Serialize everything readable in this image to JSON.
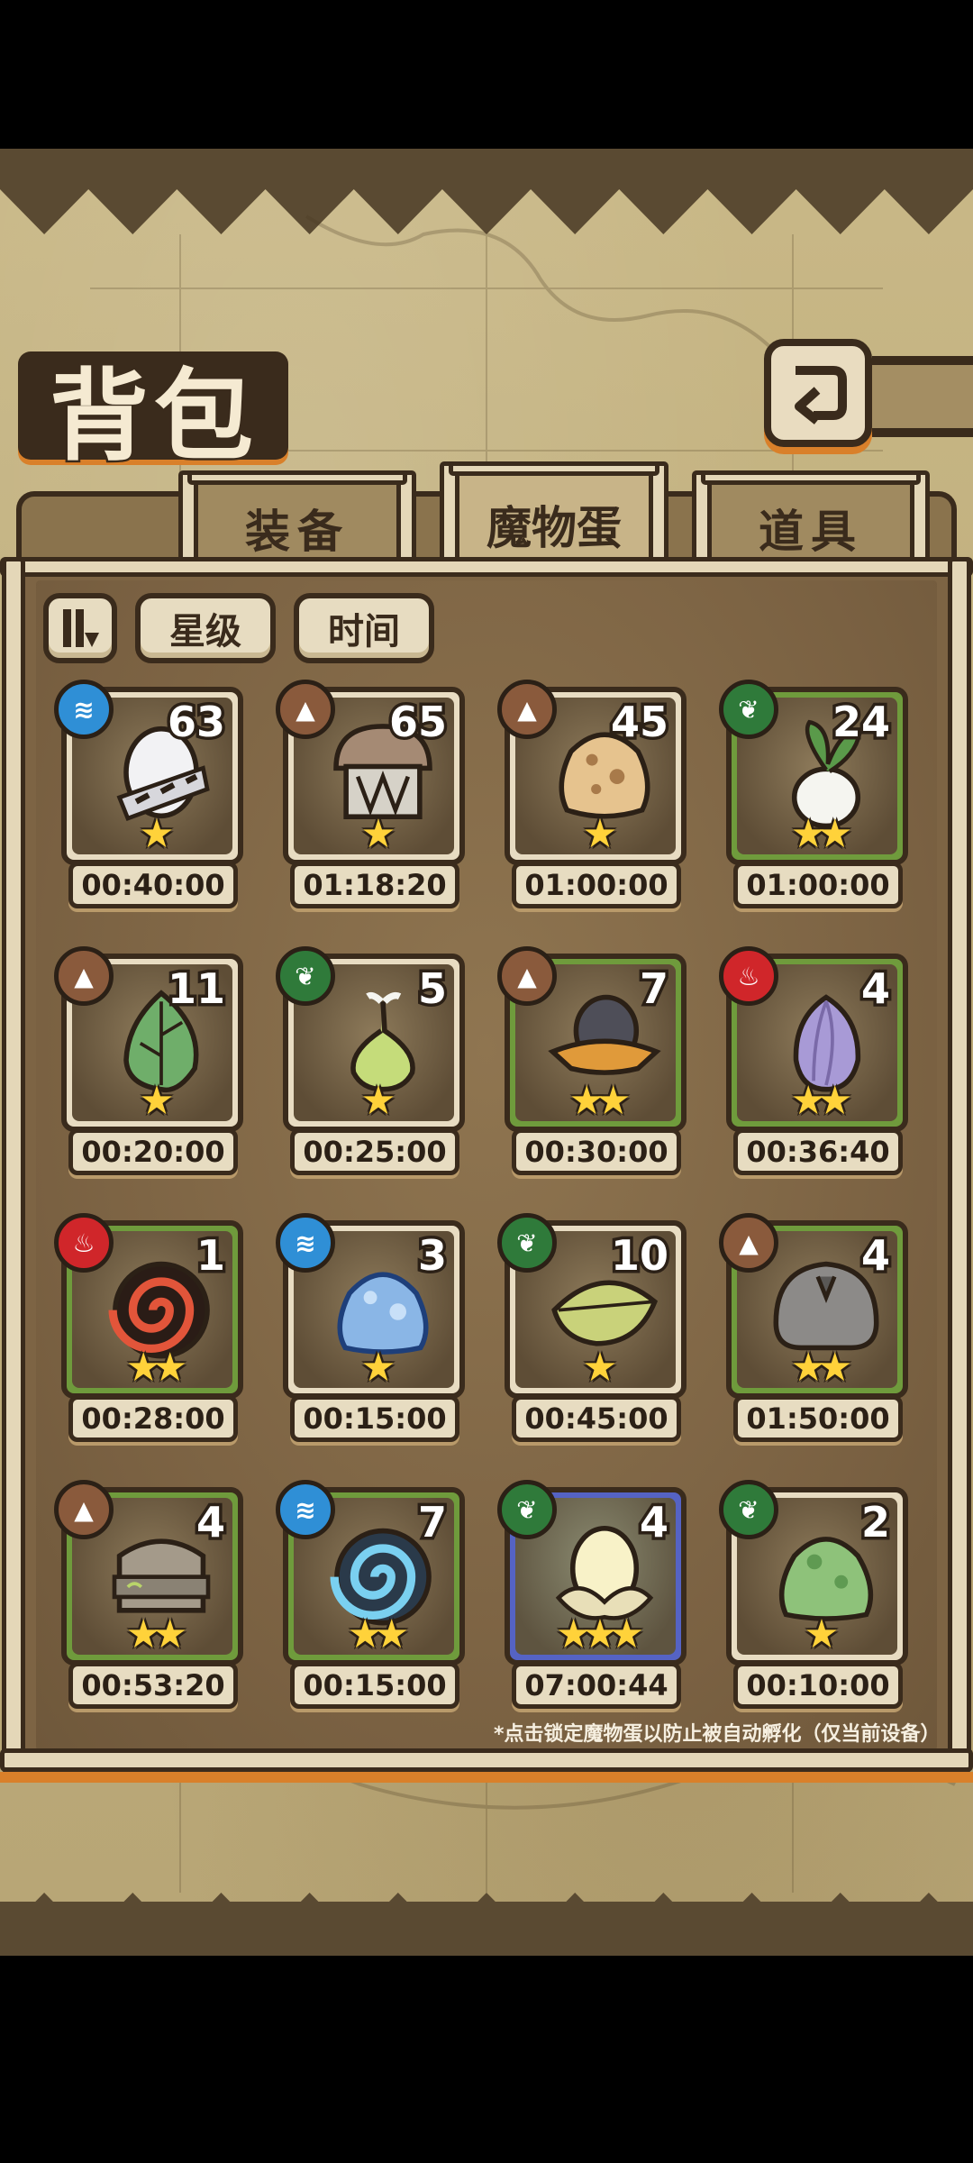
{
  "header": {
    "title": "背包",
    "back_icon": "back-arrow-icon"
  },
  "tabs": [
    {
      "label": "装备",
      "active": false
    },
    {
      "label": "魔物蛋",
      "active": true
    },
    {
      "label": "道具",
      "active": false
    }
  ],
  "sort": {
    "toggle_icon": "sort-toggle-icon",
    "star_label": "星级",
    "time_label": "时间"
  },
  "eggs": [
    {
      "element": "water",
      "count": "63",
      "stars": 1,
      "time": "00:40:00",
      "rarity": 1,
      "egg": "white-striped-egg"
    },
    {
      "element": "earth",
      "count": "65",
      "stars": 1,
      "time": "01:18:20",
      "rarity": 1,
      "egg": "mushroom-chest-egg"
    },
    {
      "element": "earth",
      "count": "45",
      "stars": 1,
      "time": "01:00:00",
      "rarity": 1,
      "egg": "sand-egg"
    },
    {
      "element": "grass",
      "count": "24",
      "stars": 2,
      "time": "01:00:00",
      "rarity": 2,
      "egg": "turnip-egg"
    },
    {
      "element": "earth",
      "count": "11",
      "stars": 1,
      "time": "00:20:00",
      "rarity": 1,
      "egg": "leaf-bud-egg"
    },
    {
      "element": "grass",
      "count": "5",
      "stars": 1,
      "time": "00:25:00",
      "rarity": 1,
      "egg": "sprout-bulb-egg"
    },
    {
      "element": "earth",
      "count": "7",
      "stars": 2,
      "time": "00:30:00",
      "rarity": 2,
      "egg": "hat-egg"
    },
    {
      "element": "fire",
      "count": "4",
      "stars": 2,
      "time": "00:36:40",
      "rarity": 2,
      "egg": "flower-bud-egg"
    },
    {
      "element": "fire",
      "count": "1",
      "stars": 2,
      "time": "00:28:00",
      "rarity": 2,
      "egg": "lava-shell-egg"
    },
    {
      "element": "water",
      "count": "3",
      "stars": 1,
      "time": "00:15:00",
      "rarity": 1,
      "egg": "blue-slime-egg"
    },
    {
      "element": "grass",
      "count": "10",
      "stars": 1,
      "time": "00:45:00",
      "rarity": 1,
      "egg": "leaf-pod-egg"
    },
    {
      "element": "earth",
      "count": "4",
      "stars": 2,
      "time": "01:50:00",
      "rarity": 2,
      "egg": "fur-egg"
    },
    {
      "element": "earth",
      "count": "4",
      "stars": 2,
      "time": "00:53:20",
      "rarity": 2,
      "egg": "stone-helmet-egg"
    },
    {
      "element": "water",
      "count": "7",
      "stars": 2,
      "time": "00:15:00",
      "rarity": 2,
      "egg": "blue-shell-egg"
    },
    {
      "element": "grass",
      "count": "4",
      "stars": 3,
      "time": "07:00:44",
      "rarity": 3,
      "egg": "golden-lotus-egg"
    },
    {
      "element": "grass",
      "count": "2",
      "stars": 1,
      "time": "00:10:00",
      "rarity": 1,
      "egg": "green-slime-egg"
    }
  ],
  "hint": "*点击锁定魔物蛋以防止被自动孵化（仅当前设备）",
  "colors": {
    "frame_dark": "#3a2b1c",
    "parchment": "#c9b887",
    "accent_orange": "#d9802a",
    "rarity_green": "#6f9b3c",
    "rarity_blue": "#5563c4",
    "star_gold": "#ffd23a"
  }
}
